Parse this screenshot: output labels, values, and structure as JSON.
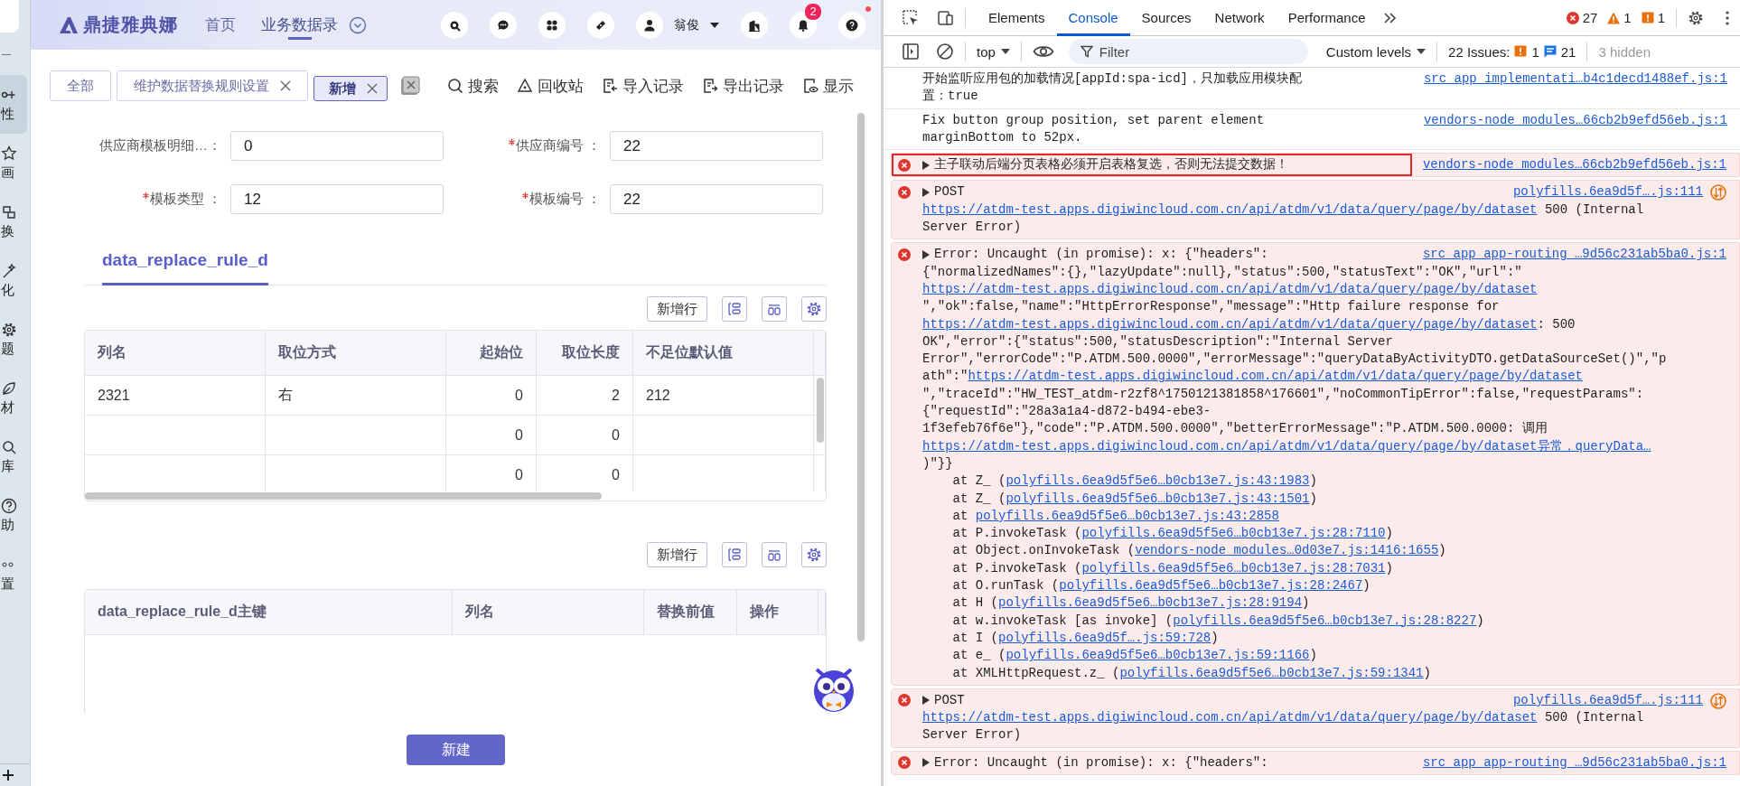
{
  "sidebar": {
    "items": [
      {
        "label": "性",
        "selected": true
      },
      {
        "label": "画",
        "selected": false
      },
      {
        "label": "换",
        "selected": false
      },
      {
        "label": "化",
        "selected": false
      },
      {
        "label": "题",
        "selected": false
      },
      {
        "label": "材",
        "selected": false
      },
      {
        "label": "库",
        "selected": false
      },
      {
        "label": "助",
        "selected": false
      },
      {
        "label": "置",
        "selected": false
      }
    ]
  },
  "header": {
    "logo": "鼎捷雅典娜",
    "nav": [
      {
        "label": "首页",
        "selected": false
      },
      {
        "label": "业务数据录",
        "selected": true
      }
    ],
    "user": {
      "name": "翁俊"
    },
    "notifications": {
      "badge": "2"
    },
    "help": {
      "alert": true
    }
  },
  "tabs": [
    {
      "label": "全部",
      "closable": false,
      "selected": false
    },
    {
      "label": "维护数据替换规则设置",
      "closable": true,
      "selected": false
    },
    {
      "label": "新增",
      "closable": true,
      "selected": true
    }
  ],
  "toolbar": [
    "搜索",
    "回收站",
    "导入记录",
    "导出记录",
    "显示"
  ],
  "form": {
    "fields": [
      {
        "label": "供应商模板明细…：",
        "required": false,
        "value": "0"
      },
      {
        "label": "供应商编号 ：",
        "required": true,
        "value": "22"
      },
      {
        "label": "模板类型 ：",
        "required": true,
        "value": "12"
      },
      {
        "label": "模板编号 ：",
        "required": true,
        "value": "22"
      }
    ]
  },
  "section_tab": {
    "label": "data_replace_rule_d",
    "selected": true
  },
  "tables": [
    {
      "add_row": "新增行",
      "columns": [
        "列名",
        "取位方式",
        "起始位",
        "取位长度",
        "不足位默认值"
      ],
      "rows": [
        [
          "2321",
          "右",
          "0",
          "2",
          "212"
        ],
        [
          null,
          null,
          "0",
          "0",
          null
        ],
        [
          null,
          null,
          "0",
          "0",
          null
        ]
      ]
    },
    {
      "add_row": "新增行",
      "columns": [
        "data_replace_rule_d主键",
        "列名",
        "替换前值",
        "操作"
      ]
    }
  ],
  "footer": {
    "create_button": "新建"
  },
  "devtools": {
    "tabs": [
      {
        "label": "Elements",
        "selected": false
      },
      {
        "label": "Console",
        "selected": true
      },
      {
        "label": "Sources",
        "selected": false
      },
      {
        "label": "Network",
        "selected": false
      },
      {
        "label": "Performance",
        "selected": false
      }
    ],
    "counts": [
      {
        "kind": "error",
        "count": "27"
      },
      {
        "kind": "warning",
        "count": "1"
      },
      {
        "kind": "issue",
        "count": "1"
      }
    ],
    "context": "top",
    "filter_placeholder": "Filter",
    "levels": "Custom levels",
    "issues": {
      "label": "22 Issues:",
      "counts": [
        {
          "kind": "issue",
          "count": "1"
        },
        {
          "kind": "message",
          "count": "21"
        }
      ]
    },
    "hidden": "3 hidden",
    "messages": [
      {
        "kind": "info",
        "expandable": false,
        "highlighted": false,
        "network": false,
        "source": "src_app_implementati…b4c1decd1488ef.js:1",
        "lines": [
          [
            {
              "text": "开始监听应用包的加载情况[appId:spa-icd]，只加载应用模块配"
            }
          ],
          [
            {
              "text": "置：true"
            }
          ]
        ]
      },
      {
        "kind": "info",
        "expandable": false,
        "highlighted": false,
        "network": false,
        "source": "vendors-node_modules…66cb2b9efd56eb.js:1",
        "lines": [
          [
            {
              "text": "Fix button group position, set parent element"
            }
          ],
          [
            {
              "text": "marginBottom to 52px."
            }
          ]
        ]
      },
      {
        "kind": "error",
        "expandable": true,
        "highlighted": true,
        "network": false,
        "source": "vendors-node_modules…66cb2b9efd56eb.js:1",
        "lines": [
          [
            {
              "text": "主子联动后端分页表格必须开启表格复选，否则无法提交数据！"
            }
          ]
        ]
      },
      {
        "kind": "error",
        "expandable": true,
        "highlighted": false,
        "network": true,
        "source": "polyfills.6ea9d5f….js:111",
        "lines": [
          [
            {
              "text": "POST"
            }
          ],
          [
            {
              "text": "https://atdm-test.apps.digiwincloud.com.cn/api/atdm/v1/data/query/page/by/dataset",
              "link": true
            },
            {
              "text": " 500 (Internal"
            }
          ],
          [
            {
              "text": "Server Error)"
            }
          ]
        ]
      },
      {
        "kind": "error",
        "expandable": true,
        "highlighted": false,
        "network": false,
        "source": "src_app_app-routing_…9d56c231ab5ba0.js:1",
        "lines": [
          [
            {
              "text": "Error: Uncaught (in promise): x: {\"headers\":"
            }
          ],
          [
            {
              "text": "{\"normalizedNames\":{},\"lazyUpdate\":null},\"status\":500,\"statusText\":\"OK\",\"url\":\""
            }
          ],
          [
            {
              "text": "https://atdm-test.apps.digiwincloud.com.cn/api/atdm/v1/data/query/page/by/dataset",
              "link": true
            }
          ],
          [
            {
              "text": "\",\"ok\":false,\"name\":\"HttpErrorResponse\",\"message\":\"Http failure response for"
            }
          ],
          [
            {
              "text": "https://atdm-test.apps.digiwincloud.com.cn/api/atdm/v1/data/query/page/by/dataset",
              "link": true
            },
            {
              "text": ": 500"
            }
          ],
          [
            {
              "text": "OK\",\"error\":{\"status\":500,\"statusDescription\":\"Internal Server"
            }
          ],
          [
            {
              "text": "Error\",\"errorCode\":\"P.ATDM.500.0000\",\"errorMessage\":\"queryDataByActivityDTO.getDataSourceSet()\",\"p"
            }
          ],
          [
            {
              "text": "ath\":\""
            },
            {
              "text": "https://atdm-test.apps.digiwincloud.com.cn/api/atdm/v1/data/query/page/by/dataset",
              "link": true
            }
          ],
          [
            {
              "text": "\",\"traceId\":\"HW_TEST_atdm-r2zf8^1750121381858^176601\",\"noCommonTipError\":false,\"requestParams\":"
            }
          ],
          [
            {
              "text": "{\"requestId\":\"28a3a1a4-d872-b494-ebe3-"
            }
          ],
          [
            {
              "text": "1f3efeb76f6e\"},\"code\":\"P.ATDM.500.0000\",\"betterErrorMessage\":\"P.ATDM.500.0000: 调用"
            }
          ],
          [
            {
              "text": "https://atdm-test.apps.digiwincloud.com.cn/api/atdm/v1/data/query/page/by/dataset异常，queryData…",
              "link": true
            }
          ],
          [
            {
              "text": ")\"}}"
            }
          ],
          [
            {
              "text": "    at Z_ ("
            },
            {
              "text": "polyfills.6ea9d5f5e6…b0cb13e7.js:43:1983",
              "link": true
            },
            {
              "text": ")"
            }
          ],
          [
            {
              "text": "    at Z_ ("
            },
            {
              "text": "polyfills.6ea9d5f5e6…b0cb13e7.js:43:1501",
              "link": true
            },
            {
              "text": ")"
            }
          ],
          [
            {
              "text": "    at "
            },
            {
              "text": "polyfills.6ea9d5f5e6…b0cb13e7.js:43:2858",
              "link": true
            }
          ],
          [
            {
              "text": "    at P.invokeTask ("
            },
            {
              "text": "polyfills.6ea9d5f5e6…b0cb13e7.js:28:7110",
              "link": true
            },
            {
              "text": ")"
            }
          ],
          [
            {
              "text": "    at Object.onInvokeTask ("
            },
            {
              "text": "vendors-node_modules…0d03e7.js:1416:1655",
              "link": true
            },
            {
              "text": ")"
            }
          ],
          [
            {
              "text": "    at P.invokeTask ("
            },
            {
              "text": "polyfills.6ea9d5f5e6…b0cb13e7.js:28:7031",
              "link": true
            },
            {
              "text": ")"
            }
          ],
          [
            {
              "text": "    at O.runTask ("
            },
            {
              "text": "polyfills.6ea9d5f5e6…b0cb13e7.js:28:2467",
              "link": true
            },
            {
              "text": ")"
            }
          ],
          [
            {
              "text": "    at H ("
            },
            {
              "text": "polyfills.6ea9d5f5e6…b0cb13e7.js:28:9194",
              "link": true
            },
            {
              "text": ")"
            }
          ],
          [
            {
              "text": "    at w.invokeTask [as invoke] ("
            },
            {
              "text": "polyfills.6ea9d5f5e6…b0cb13e7.js:28:8227",
              "link": true
            },
            {
              "text": ")"
            }
          ],
          [
            {
              "text": "    at I ("
            },
            {
              "text": "polyfills.6ea9d5f….js:59:728",
              "link": true
            },
            {
              "text": ")"
            }
          ],
          [
            {
              "text": "    at e_ ("
            },
            {
              "text": "polyfills.6ea9d5f5e6…b0cb13e7.js:59:1166",
              "link": true
            },
            {
              "text": ")"
            }
          ],
          [
            {
              "text": "    at XMLHttpRequest.z_ ("
            },
            {
              "text": "polyfills.6ea9d5f5e6…b0cb13e7.js:59:1341",
              "link": true
            },
            {
              "text": ")"
            }
          ]
        ]
      },
      {
        "kind": "error",
        "expandable": true,
        "highlighted": false,
        "network": true,
        "source": "polyfills.6ea9d5f….js:111",
        "lines": [
          [
            {
              "text": "POST"
            }
          ],
          [
            {
              "text": "https://atdm-test.apps.digiwincloud.com.cn/api/atdm/v1/data/query/page/by/dataset",
              "link": true
            },
            {
              "text": " 500 (Internal"
            }
          ],
          [
            {
              "text": "Server Error)"
            }
          ]
        ]
      },
      {
        "kind": "error",
        "expandable": true,
        "highlighted": false,
        "network": false,
        "source": "src_app_app-routing_…9d56c231ab5ba0.js:1",
        "lines": [
          [
            {
              "text": "Error: Uncaught (in promise): x: {\"headers\":"
            }
          ]
        ]
      }
    ]
  }
}
